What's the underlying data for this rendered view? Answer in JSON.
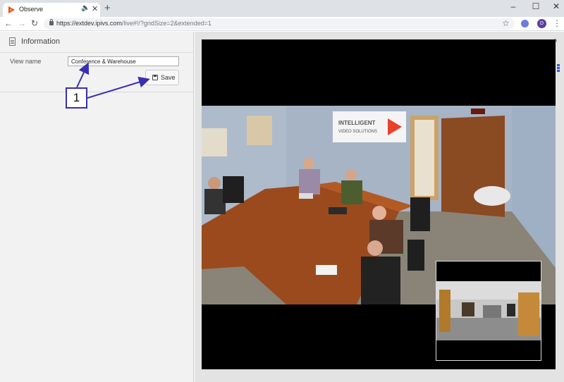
{
  "browser": {
    "tab": {
      "title": "Observe"
    },
    "url": {
      "domain": "https://extdev.ipivs.com",
      "path": "/live#!/?gridSize=2&extended=1"
    },
    "profile_initial": "D"
  },
  "sidebar": {
    "header_title": "Information",
    "view_name_label": "View name",
    "view_name_value": "Conference & Warehouse",
    "save_label": "Save"
  },
  "annotation": {
    "callout_number": "1"
  },
  "camera": {
    "sign_line1": "INTELLIGENT",
    "sign_line2": "VIDEO SOLUTIONS"
  },
  "colors": {
    "accent": "#3a2fb0",
    "brand_orange": "#e8432a",
    "sidebar_bg": "#f2f2f2"
  },
  "icons": {
    "favicon": "play-triangle-icon",
    "panel_header": "document-icon",
    "save": "floppy-disk-icon"
  }
}
